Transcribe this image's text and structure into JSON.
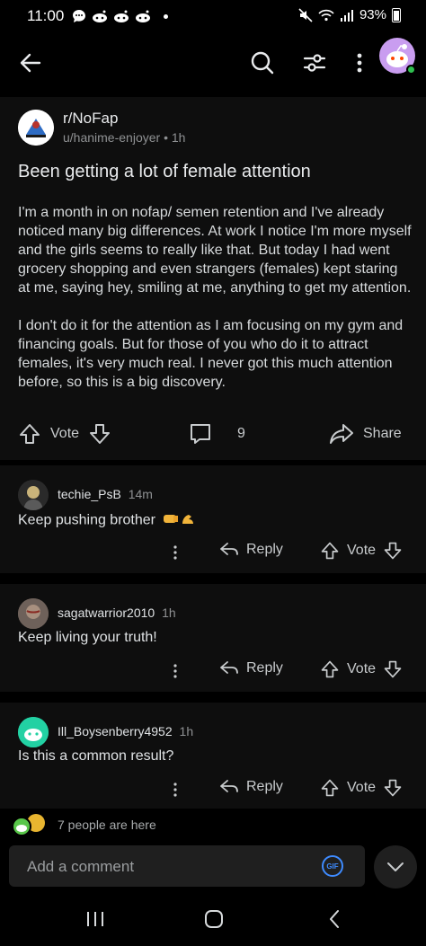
{
  "status_bar": {
    "time": "11:00",
    "battery": "93%"
  },
  "post": {
    "subreddit": "r/NoFap",
    "author": "u/hanime-enjoyer",
    "separator": "•",
    "age": "1h",
    "title": "Been getting a lot of female attention",
    "body": [
      "I'm a month in on nofap/ semen retention and I've already noticed many big differences. At work I notice I'm more myself and the girls seems to really like that. But today I had went grocery shopping and even strangers (females) kept staring at me, saying hey, smiling at me, anything to get my attention.",
      "I don't do it for the attention as I am focusing on my gym and financing goals. But for those of you who do it to attract females, it's very much real. I never got this much attention before, so this is a big discovery."
    ],
    "vote_label": "Vote",
    "comment_count": "9",
    "share_label": "Share"
  },
  "comments": [
    {
      "user": "techie_PsB",
      "age": "14m",
      "text": "Keep pushing brother",
      "reply_label": "Reply",
      "vote_label": "Vote"
    },
    {
      "user": "sagatwarrior2010",
      "age": "1h",
      "text": "Keep living your truth!",
      "reply_label": "Reply",
      "vote_label": "Vote"
    },
    {
      "user": "Ill_Boysenberry4952",
      "age": "1h",
      "text": "Is this a common result?",
      "reply_label": "Reply",
      "vote_label": "Vote"
    }
  ],
  "presence": {
    "text": "7 people are here"
  },
  "composer": {
    "placeholder": "Add a comment",
    "gif_label": "GIF"
  },
  "colors": {
    "accent_blue": "#3e8bff",
    "online_green": "#2fbf4f",
    "avatar_purple": "#c99df0"
  }
}
